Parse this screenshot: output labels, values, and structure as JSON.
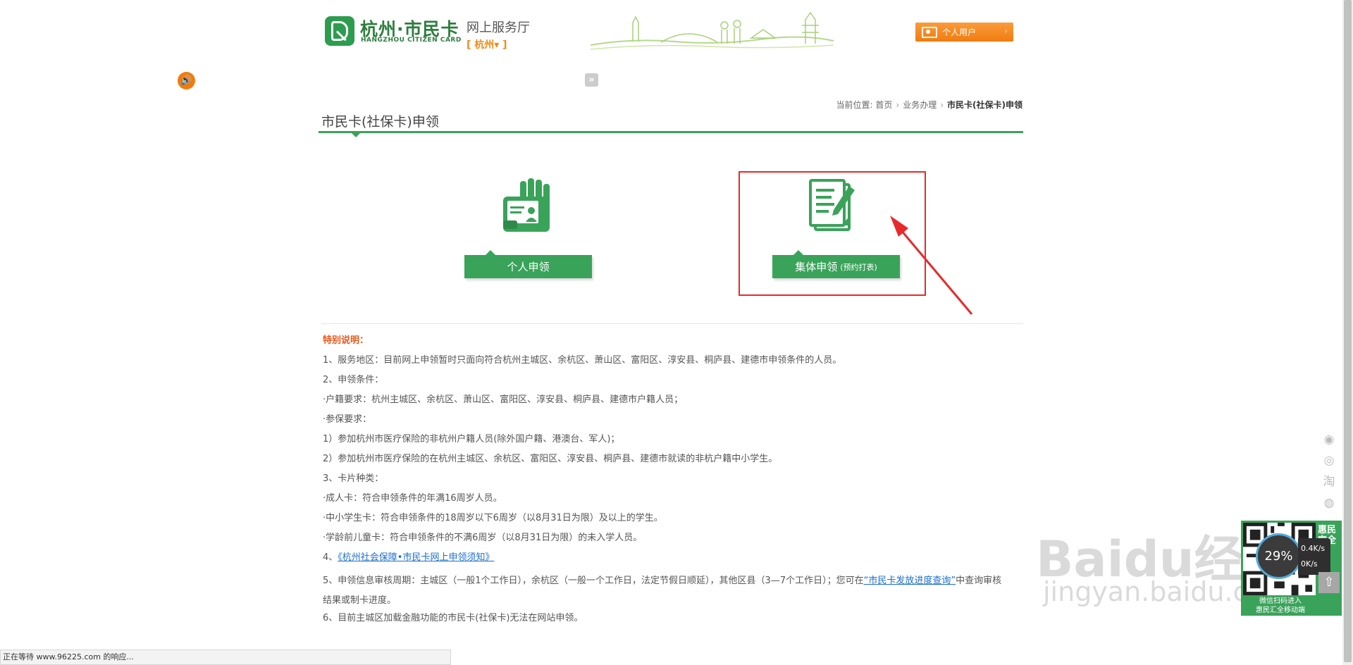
{
  "header": {
    "logo_cn": "杭州·市民卡",
    "logo_en": "HANGZHOU CITIZEN CARD",
    "hall_title": "网上服务厅",
    "city_select": "[ 杭州▾  ]",
    "user_button": "个人用户"
  },
  "breadcrumb": {
    "label": "当前位置:",
    "items": [
      "首页",
      "业务办理"
    ],
    "current": "市民卡(社保卡)申领"
  },
  "page": {
    "title": "市民卡(社保卡)申领"
  },
  "options": {
    "personal": {
      "label": "个人申领"
    },
    "group": {
      "label": "集体申领",
      "sub": "(预约打表)"
    }
  },
  "notes": {
    "heading": "特别说明：",
    "lines": [
      "1、服务地区：目前网上申领暂时只面向符合杭州主城区、余杭区、萧山区、富阳区、淳安县、桐庐县、建德市申领条件的人员。",
      "2、申领条件：",
      "·户籍要求：杭州主城区、余杭区、萧山区、富阳区、淳安县、桐庐县、建德市户籍人员；",
      "·参保要求：",
      "1）参加杭州市医疗保险的非杭州户籍人员(除外国户籍、港澳台、军人)；",
      "2）参加杭州市医疗保险的在杭州主城区、余杭区、富阳区、淳安县、桐庐县、建德市就读的非杭户籍中小学生。",
      "3、卡片种类：",
      "·成人卡：符合申领条件的年满16周岁人员。",
      "·中小学生卡：符合申领条件的18周岁以下6周岁（以8月31日为限）及以上的学生。",
      "·学龄前儿童卡：符合申领条件的不满6周岁（以8月31日为限）的未入学人员。"
    ],
    "line4_prefix": "4、",
    "line4_link": "《杭州社会保障•市民卡网上申领须知》",
    "line5_prefix": "5、申领信息审核周期：主城区（一般1个工作日），余杭区（一般一个工作日，法定节假日顺延），其他区县（3—7个工作日）；您可在",
    "line5_link": "“市民卡发放进度查询”",
    "line5_suffix": "中查询审核结果或制卡进度。",
    "line6": "6、目前主城区加载金融功能的市民卡(社保卡)无法在网站申领。"
  },
  "side": {
    "qr_side": "惠民\n完全",
    "qr_caption": "微信扫码进入\n惠民汇全移动端",
    "speed_percent": "29%",
    "speed_up": "0.4K/s",
    "speed_down": "0K/s"
  },
  "watermark": {
    "text": "Baidu经验",
    "url": "jingyan.baidu.com"
  },
  "statusbar": {
    "text": "正在等待 www.96225.com 的响应..."
  },
  "icons": {
    "sound": "speaker-icon",
    "expand": "double-chevron-right-icon",
    "to_top": "arrow-up-icon"
  },
  "colors": {
    "brand_green": "#3aa35a",
    "accent_orange": "#f07c10",
    "highlight_red": "#e8292b",
    "link_blue": "#1a6fc9"
  }
}
